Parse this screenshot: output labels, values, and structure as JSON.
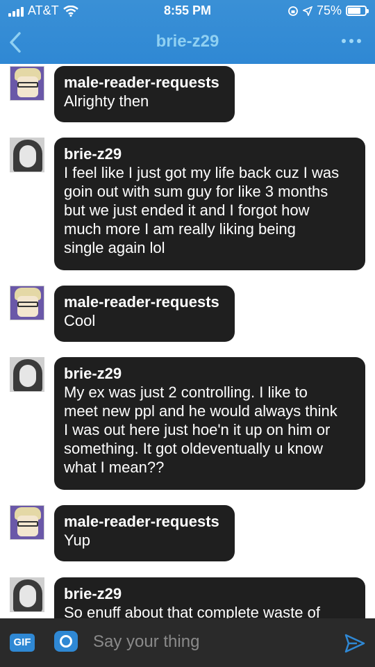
{
  "status_bar": {
    "carrier": "AT&T",
    "time": "8:55 PM",
    "battery_percent": "75%",
    "battery_level": 0.75
  },
  "nav": {
    "title": "brie-z29",
    "back_icon": "chevron-left-icon",
    "more_icon": "ellipsis-icon"
  },
  "messages": [
    {
      "sender": "male-reader-requests",
      "text": "Alrighty then",
      "avatar": "male-avatar"
    },
    {
      "sender": "brie-z29",
      "text": "I feel like I just got my life back cuz I was\ngoin out with sum guy for like 3 months\nbut we just ended it and I forgot how\nmuch more I am really liking being\nsingle again lol",
      "avatar": "female-avatar"
    },
    {
      "sender": "male-reader-requests",
      "text": "Cool",
      "avatar": "male-avatar"
    },
    {
      "sender": "brie-z29",
      "text": "My ex was just 2 controlling. I like to\nmeet new ppl and he would always think\nI was out here just hoe'n it up on him or\nsomething. It got oldeventually u know\nwhat I mean??",
      "avatar": "female-avatar"
    },
    {
      "sender": "male-reader-requests",
      "text": "Yup",
      "avatar": "male-avatar"
    },
    {
      "sender": "brie-z29",
      "text": "So enuff about that complete waste of",
      "avatar": "female-avatar"
    }
  ],
  "composer": {
    "gif_label": "GIF",
    "placeholder": "Say your thing",
    "camera_icon": "camera-icon",
    "send_icon": "send-icon"
  },
  "colors": {
    "header_blue": "#2f88d4",
    "title_blue": "#8fd0f2",
    "bubble_bg": "#1f1f1f",
    "composer_bg": "#2a2a2a"
  }
}
